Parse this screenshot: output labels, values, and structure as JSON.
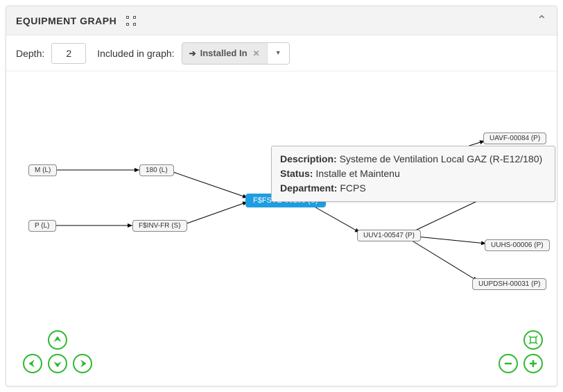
{
  "header": {
    "title": "EQUIPMENT GRAPH"
  },
  "toolbar": {
    "depth_label": "Depth:",
    "depth_value": "2",
    "included_label": "Included in graph:",
    "chip_label": "Installed In"
  },
  "tooltip": {
    "description_label": "Description:",
    "description_value": "Systeme de Ventilation Local GAZ (R-E12/180)",
    "status_label": "Status:",
    "status_value": "Installe et Maintenu",
    "department_label": "Department:",
    "department_value": "FCPS"
  },
  "nodes": {
    "m": "M (L)",
    "p": "P (L)",
    "n180": "180 (L)",
    "finvfr": "F$INV-FR (S)",
    "fsve": "F$FSVE-00103 (S)",
    "uuv1": "UUV1-00547 (P)",
    "uavf": "UAVF-00084 (P)",
    "uuhs": "UUHS-00006 (P)",
    "uupdsh": "UUPDSH-00031 (P)"
  },
  "chart_data": {
    "type": "graph",
    "title": "EQUIPMENT GRAPH",
    "depth": 2,
    "relation": "Installed In",
    "nodes": [
      {
        "id": "m",
        "label": "M (L)"
      },
      {
        "id": "p",
        "label": "P (L)"
      },
      {
        "id": "n180",
        "label": "180 (L)"
      },
      {
        "id": "finvfr",
        "label": "F$INV-FR (S)"
      },
      {
        "id": "fsve",
        "label": "F$FSVE-00103 (S)",
        "selected": true,
        "tooltip": {
          "Description": "Systeme de Ventilation Local GAZ (R-E12/180)",
          "Status": "Installe et Maintenu",
          "Department": "FCPS"
        }
      },
      {
        "id": "uuv1",
        "label": "UUV1-00547 (P)"
      },
      {
        "id": "uavf",
        "label": "UAVF-00084 (P)"
      },
      {
        "id": "uuhs",
        "label": "UUHS-00006 (P)"
      },
      {
        "id": "uupdsh",
        "label": "UUPDSH-00031 (P)"
      }
    ],
    "edges": [
      {
        "from": "m",
        "to": "n180"
      },
      {
        "from": "p",
        "to": "finvfr"
      },
      {
        "from": "n180",
        "to": "fsve"
      },
      {
        "from": "finvfr",
        "to": "fsve"
      },
      {
        "from": "fsve",
        "to": "uuv1"
      },
      {
        "from": "fsve",
        "to": "uavf"
      },
      {
        "from": "uuv1",
        "to": "uavf"
      },
      {
        "from": "uuv1",
        "to": "uuhs"
      },
      {
        "from": "uuv1",
        "to": "uupdsh"
      }
    ]
  }
}
